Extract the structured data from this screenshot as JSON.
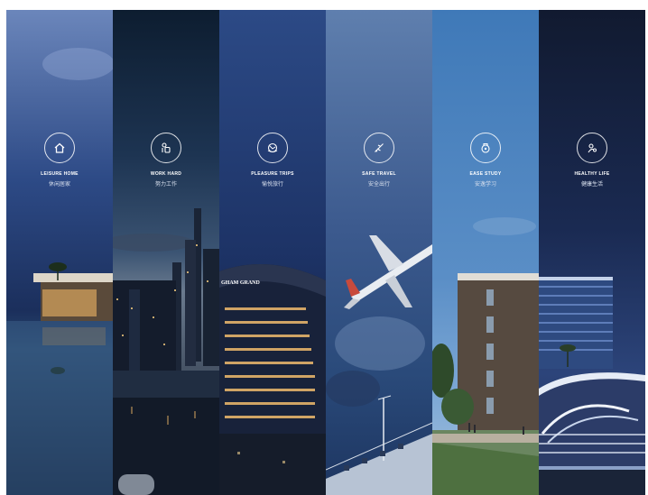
{
  "panels": [
    {
      "title": "LEISURE HOME",
      "subtitle": "休闲居家",
      "icon": "home-icon"
    },
    {
      "title": "WORK HARD",
      "subtitle": "努力工作",
      "icon": "work-icon"
    },
    {
      "title": "PLEASURE TRIPS",
      "subtitle": "愉悦旅行",
      "icon": "globe-icon"
    },
    {
      "title": "SAFE TRAVEL",
      "subtitle": "安全出行",
      "icon": "plane-icon"
    },
    {
      "title": "EASE STUDY",
      "subtitle": "安逸学习",
      "icon": "study-icon"
    },
    {
      "title": "HEALTHY LIFE",
      "subtitle": "健康生活",
      "icon": "health-icon"
    }
  ],
  "hotel_sign": "GHAM GRAND"
}
